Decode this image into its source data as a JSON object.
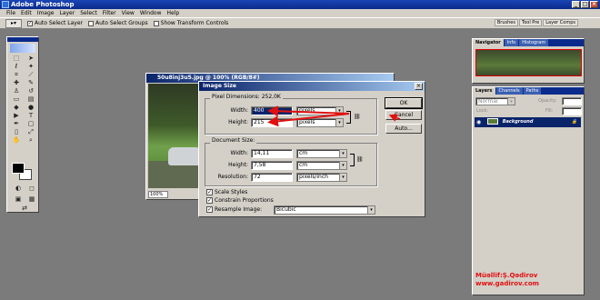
{
  "app": {
    "title": "Adobe Photoshop",
    "menu": [
      "File",
      "Edit",
      "Image",
      "Layer",
      "Select",
      "Filter",
      "View",
      "Window",
      "Help"
    ]
  },
  "options_bar": {
    "auto_select_layer": "Auto Select Layer",
    "auto_select_groups": "Auto Select Groups",
    "show_transform_controls": "Show Transform Controls"
  },
  "palette_well": {
    "tabs": [
      "Brushes",
      "Tool Pre",
      "Layer Comps"
    ]
  },
  "document": {
    "title": "50u8inj3u5.jpg @ 100% (RGB/8#)",
    "zoom": "100%"
  },
  "dialog": {
    "title": "Image Size",
    "pixel_dimensions_label": "Pixel Dimensions: 252,0K",
    "width_label": "Width:",
    "width_value": "400",
    "width_unit": "pixels",
    "height_label": "Height:",
    "height_value": "215",
    "height_unit": "pixels",
    "document_size_label": "Document Size:",
    "doc_width_label": "Width:",
    "doc_width_value": "14,11",
    "doc_width_unit": "cm",
    "doc_height_label": "Height:",
    "doc_height_value": "7,58",
    "doc_height_unit": "cm",
    "resolution_label": "Resolution:",
    "resolution_value": "72",
    "resolution_unit": "pixels/inch",
    "scale_styles": "Scale Styles",
    "constrain_proportions": "Constrain Proportions",
    "resample_image": "Resample Image:",
    "resample_method": "Bicubic",
    "ok": "OK",
    "cancel": "Cancel",
    "auto": "Auto..."
  },
  "navigator": {
    "tabs": [
      "Navigator",
      "Info",
      "Histogram"
    ]
  },
  "layers": {
    "tabs": [
      "Layers",
      "Channels",
      "Paths"
    ],
    "blend_mode": "Normal",
    "opacity_label": "Opacity:",
    "lock_label": "Lock:",
    "fill_label": "Fill:",
    "layer_name": "Background"
  },
  "watermark": {
    "line1": "Müəllif:Ş.Qədirov",
    "line2": "www.gadirov.com"
  },
  "colors": {
    "title_blue": "#0a2a8c",
    "arrow_red": "#e01010"
  }
}
